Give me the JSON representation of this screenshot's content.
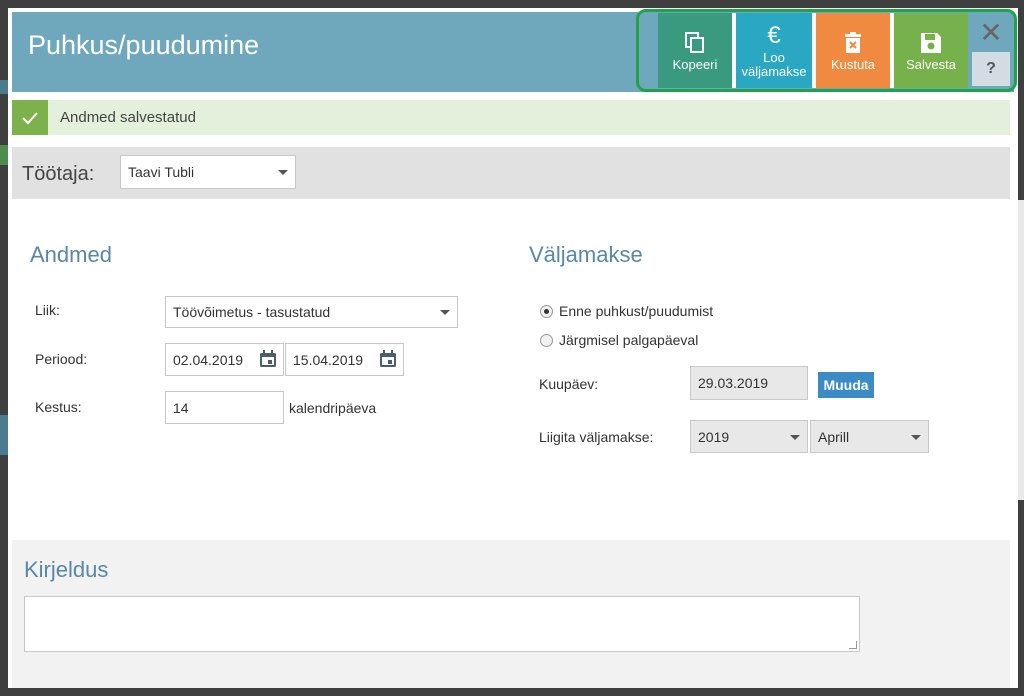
{
  "dialog": {
    "title": "Puhkus/puudumine"
  },
  "toolbar": {
    "copy_label": "Kopeeri",
    "payment_label": "Loo väljamakse",
    "delete_label": "Kustuta",
    "save_label": "Salvesta",
    "close_symbol": "✕",
    "help_label": "?",
    "colors": {
      "copy": "#3a9a80",
      "payment": "#2aa7c3",
      "delete": "#f08a41",
      "save": "#77b14b",
      "highlight": "#1fa34a"
    }
  },
  "alert": {
    "message": "Andmed salvestatud",
    "color": "#7cb14c"
  },
  "employee": {
    "label": "Töötaja:",
    "selected": "Taavi Tubli"
  },
  "andmed": {
    "heading": "Andmed",
    "type_label": "Liik:",
    "type_value": "Töövõimetus - tasustatud",
    "period_label": "Periood:",
    "period_start": "02.04.2019",
    "period_end": "15.04.2019",
    "duration_label": "Kestus:",
    "duration_value": "14",
    "duration_unit": "kalendripäeva"
  },
  "valjamakse": {
    "heading": "Väljamakse",
    "radio_before": "Enne puhkust/puudumist",
    "radio_next": "Järgmisel palgapäeval",
    "selected_option": "before",
    "date_label": "Kuupäev:",
    "date_value": "29.03.2019",
    "change_label": "Muuda",
    "assign_label": "Liigita väljamakse:",
    "year": "2019",
    "month": "Aprill"
  },
  "description": {
    "heading": "Kirjeldus",
    "value": ""
  }
}
